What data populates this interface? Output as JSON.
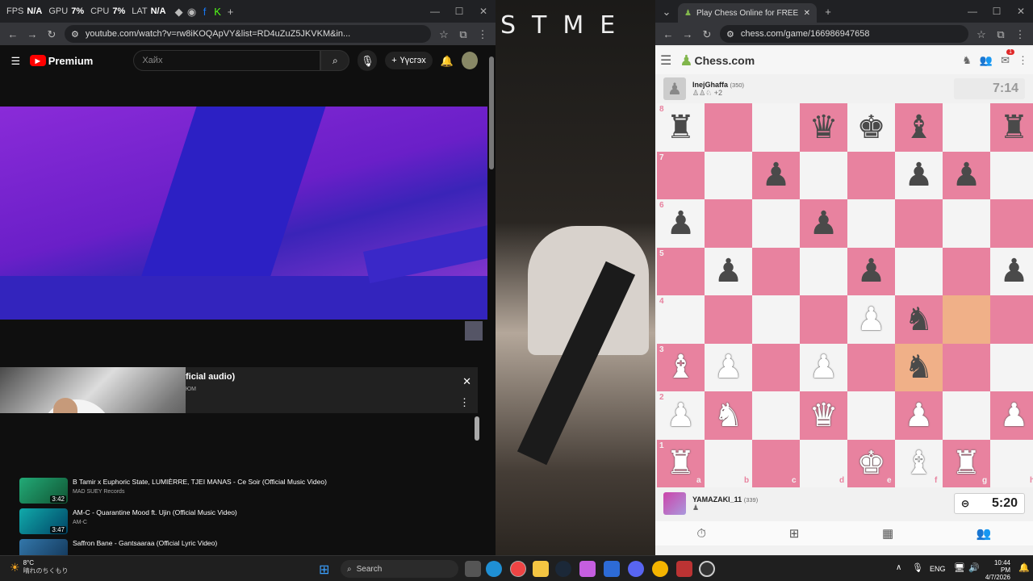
{
  "overlay": {
    "fps_label": "FPS",
    "fps_value": "N/A",
    "gpu_label": "GPU",
    "gpu_value": "7%",
    "cpu_label": "CPU",
    "cpu_value": "7%",
    "lat_label": "LAT",
    "lat_value": "N/A"
  },
  "youtube": {
    "url": "youtube.com/watch?v=rw8iKOQApVY&list=RD4uZuZ5JKVKM&in...",
    "logo": "Premium",
    "search_placeholder": "Хайх",
    "create_label": "Үүсгэх",
    "playlist_title": "ficial audio)",
    "playlist_sub": "ЮМ",
    "items": [
      {
        "title": "B Tamir x Euphoric State, LUMIÈRRE, TJEI MANAS - Ce Soir (Official Music Video)",
        "channel": "MAD SUEY Records",
        "duration": "3:42"
      },
      {
        "title": "AM-C - Quarantine Mood ft. Ujin (Official Music Video)",
        "channel": "AM-C",
        "duration": "3:47"
      },
      {
        "title": "Saffron Bane - Gantsaaraa (Official Lyric Video)",
        "channel": "",
        "duration": ""
      }
    ]
  },
  "middle": {
    "letters": "STME"
  },
  "chess": {
    "tab_title": "Play Chess Online for FREE - 2 P",
    "url": "chess.com/game/166986947658",
    "logo": "Chess.com",
    "notif_count": "1",
    "top_player": {
      "name": "InejGhaffa",
      "rating": "(350)",
      "extra": "+2",
      "clock": "7:14"
    },
    "bottom_player": {
      "name": "YAMAZAKI_11",
      "rating": "(339)",
      "clock": "5:20"
    },
    "ranks": [
      "8",
      "7",
      "6",
      "5",
      "4",
      "3",
      "2",
      "1"
    ],
    "files": [
      "a",
      "b",
      "c",
      "d",
      "e",
      "f",
      "g",
      "h"
    ],
    "position": [
      [
        "br",
        "",
        "",
        "bq",
        "bk",
        "bb",
        "",
        "br"
      ],
      [
        "",
        "",
        "bp",
        "",
        "",
        "bp",
        "bp",
        ""
      ],
      [
        "bp",
        "",
        "",
        "bp",
        "",
        "",
        "",
        ""
      ],
      [
        "",
        "bp",
        "",
        "",
        "bp",
        "",
        "",
        "bp"
      ],
      [
        "",
        "",
        "",
        "",
        "wp",
        "bn",
        "",
        ""
      ],
      [
        "wb",
        "wp",
        "",
        "wp",
        "",
        "bn",
        "",
        ""
      ],
      [
        "wp",
        "wn",
        "",
        "wq",
        "",
        "wp",
        "",
        "wp"
      ],
      [
        "wr",
        "",
        "",
        "",
        "wk",
        "wb",
        "wr",
        ""
      ]
    ],
    "highlight": [
      "g4",
      "f3"
    ],
    "colors": {
      "light": "#f4f4f4",
      "dark": "#e8829f",
      "highlight": "#f0b088"
    }
  },
  "taskbar": {
    "temp": "8°C",
    "weather": "晴れのちくもり",
    "search": "Search",
    "lang": "ENG",
    "time": "10:44 PM",
    "date": "4/7/2026"
  }
}
